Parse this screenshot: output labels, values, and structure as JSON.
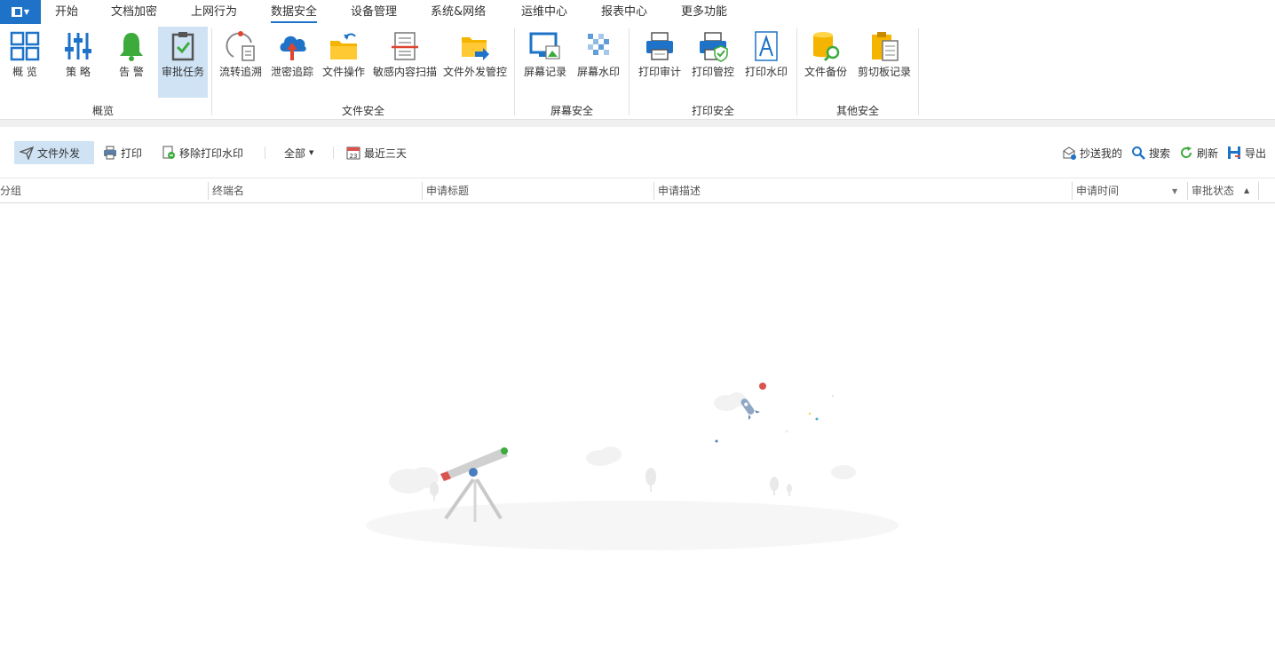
{
  "menu": {
    "tabs": [
      "开始",
      "文档加密",
      "上网行为",
      "数据安全",
      "设备管理",
      "系统&网络",
      "运维中心",
      "报表中心",
      "更多功能"
    ],
    "active": "数据安全"
  },
  "ribbon": {
    "buttons": [
      "概 览",
      "策 略",
      "告 警",
      "审批任务",
      "流转追溯",
      "泄密追踪",
      "文件操作",
      "敏感内容扫描",
      "文件外发管控",
      "屏幕记录",
      "屏幕水印",
      "打印审计",
      "打印管控",
      "打印水印",
      "文件备份",
      "剪切板记录"
    ],
    "groups": [
      "概览",
      "文件安全",
      "屏幕安全",
      "打印安全",
      "其他安全"
    ]
  },
  "toolbar": {
    "send_out": "文件外发",
    "print": "打印",
    "remove_watermark": "移除打印水印",
    "filter_all": "全部",
    "date_range": "最近三天",
    "cc_me": "抄送我的",
    "search": "搜索",
    "refresh": "刷新",
    "export": "导出",
    "calendar_day": "23"
  },
  "table": {
    "columns": [
      "分组",
      "终端名",
      "申请标题",
      "申请描述",
      "申请时间",
      "审批状态"
    ]
  },
  "colors": {
    "accent": "#1e73c8",
    "selected": "#cfe3f5"
  }
}
